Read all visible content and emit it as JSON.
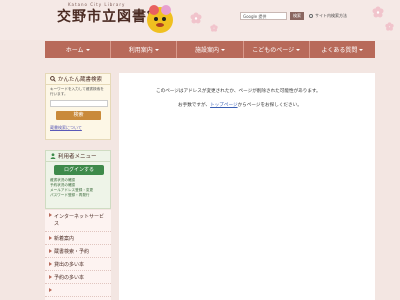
{
  "header": {
    "subtitle": "Katano City Library",
    "title": "交野市立図書館",
    "search_placeholder": "Google 提供",
    "search_button": "検索",
    "radio_label": "サイト内検索方法"
  },
  "nav": {
    "items": [
      {
        "label": "ホーム"
      },
      {
        "label": "利用案内"
      },
      {
        "label": "施設案内"
      },
      {
        "label": "こどものページ"
      },
      {
        "label": "よくある質問"
      }
    ]
  },
  "sidebar": {
    "easy_search": {
      "title": "かんたん蔵書検索",
      "instruction": "キーワードを入力して蔵書検索を行います。",
      "button": "検索",
      "help_link": "蔵書検索について"
    },
    "user_menu": {
      "title": "利用者メニュー",
      "login_button": "ログインする",
      "links": [
        "蔵書状況の確認",
        "予約状況の確認",
        "メールアドレス登録・変更",
        "パスワード登録・再発行"
      ]
    },
    "menu": {
      "items": [
        {
          "label": "インターネットサービス",
          "tall": true
        },
        {
          "label": "新着案内",
          "tall": false
        },
        {
          "label": "蔵書検索・予約",
          "tall": false
        },
        {
          "label": "貸出の多い本",
          "tall": false
        },
        {
          "label": "予約の多い本",
          "tall": false
        },
        {
          "label": "",
          "tall": false
        }
      ]
    }
  },
  "main": {
    "message_line1": "このページはアドレスが変更されたか、ページが削除された可能性があります。",
    "message_prefix": "お手数ですが、",
    "top_link": "トップページ",
    "message_suffix": "からページをお探しください。"
  },
  "colors": {
    "nav": "#b86a5a",
    "background": "#f3e6e2",
    "search_button": "#c98a3a",
    "login_button": "#3e8a4a"
  }
}
